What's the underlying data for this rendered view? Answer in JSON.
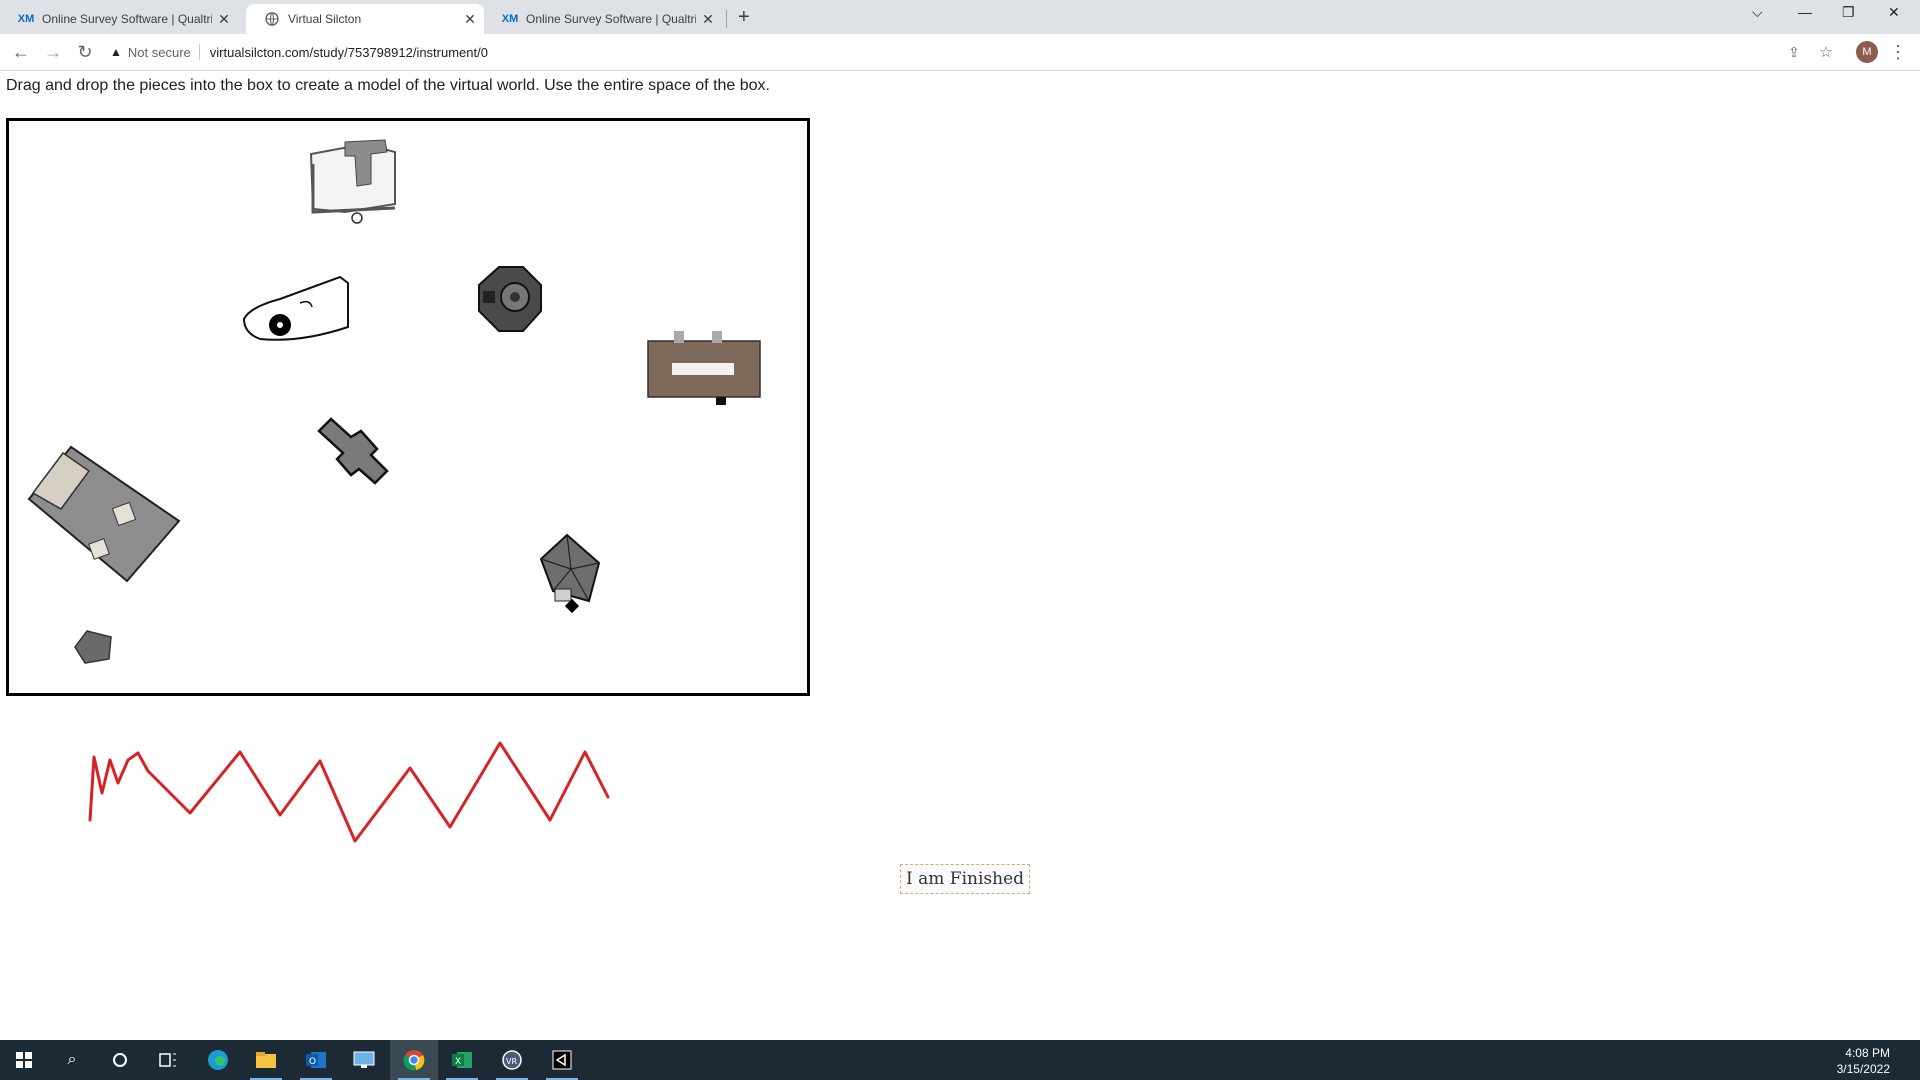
{
  "tabs": [
    {
      "title": "Online Survey Software | Qualtric",
      "favicon": "XM",
      "active": false
    },
    {
      "title": "Virtual Silcton",
      "favicon": "globe-icon",
      "active": true
    },
    {
      "title": "Online Survey Software | Qualtric",
      "favicon": "XM",
      "active": false
    }
  ],
  "address": {
    "security_label": "Not secure",
    "url": "virtualsilcton.com/study/753798912/instrument/0"
  },
  "profile_initial": "M",
  "instructions": "Drag and drop the pieces into the box to create a model of the virtual world. Use the entire space of the box.",
  "pieces": [
    {
      "name": "building-t-shaped"
    },
    {
      "name": "building-octagon"
    },
    {
      "name": "building-outline-boat"
    },
    {
      "name": "building-brown-rect"
    },
    {
      "name": "building-cross"
    },
    {
      "name": "building-large-gray"
    },
    {
      "name": "building-pyramid-roof"
    },
    {
      "name": "building-small-gray"
    }
  ],
  "finish_button": "I am Finished",
  "colors": {
    "scribble": "#d62424",
    "box_border": "#000000",
    "finish_border": "#e3a56b",
    "taskbar": "#1b2a35"
  },
  "taskbar": {
    "apps": [
      "start-icon",
      "search-icon",
      "cortana-icon",
      "task-view-icon",
      "edge-icon",
      "file-explorer-icon",
      "outlook-icon",
      "remote-desktop-icon",
      "chrome-icon",
      "excel-icon",
      "vr-app-icon",
      "unity-icon"
    ],
    "time": "4:08 PM",
    "date": "3/15/2022"
  }
}
